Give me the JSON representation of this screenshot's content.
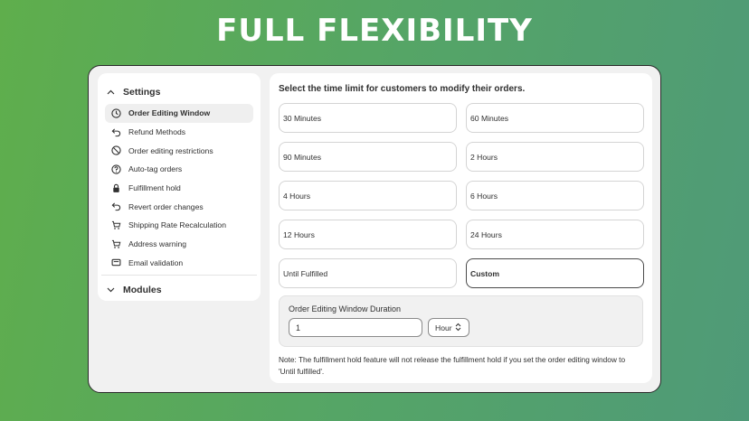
{
  "hero": {
    "title": "FULL FLEXIBILITY"
  },
  "sidebar": {
    "settings_label": "Settings",
    "items": [
      {
        "label": "Order Editing Window",
        "icon": "clock-icon",
        "active": true
      },
      {
        "label": "Refund Methods",
        "icon": "undo-arrow-icon"
      },
      {
        "label": "Order editing restrictions",
        "icon": "prohibited-icon"
      },
      {
        "label": "Auto-tag orders",
        "icon": "question-circle-icon"
      },
      {
        "label": "Fulfillment hold",
        "icon": "lock-icon"
      },
      {
        "label": "Revert order changes",
        "icon": "undo-arrow-icon"
      },
      {
        "label": "Shipping Rate Recalculation",
        "icon": "cart-icon"
      },
      {
        "label": "Address warning",
        "icon": "cart-icon"
      },
      {
        "label": "Email validation",
        "icon": "envelope-icon"
      }
    ],
    "modules_label": "Modules"
  },
  "main": {
    "heading": "Select the time limit for customers to modify their orders.",
    "options": [
      "30 Minutes",
      "60 Minutes",
      "90 Minutes",
      "2 Hours",
      "4 Hours",
      "6 Hours",
      "12 Hours",
      "24 Hours",
      "Until Fulfilled",
      "Custom"
    ],
    "selected_option": "Custom",
    "duration": {
      "label": "Order Editing Window Duration",
      "value": "1",
      "unit": "Hour"
    },
    "note": "Note: The fulfillment hold feature will not release the fulfillment hold if you set the order editing window to 'Until fulfilled'."
  }
}
